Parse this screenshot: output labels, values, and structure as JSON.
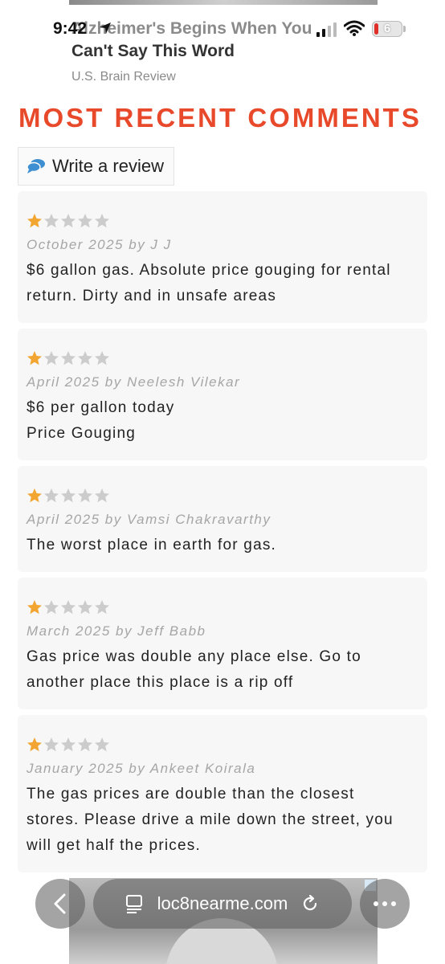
{
  "status_bar": {
    "time": "9:42",
    "battery_level": "6"
  },
  "ad_top": {
    "headline_line1": "Alzheimer's Begins When You",
    "headline_line2": "Can't Say This Word",
    "source": "U.S. Brain Review"
  },
  "section_title": "MOST RECENT COMMENTS",
  "write_review_label": "Write a review",
  "colors": {
    "accent": "#e8492a",
    "star_filled": "#f2a531",
    "star_empty": "#cccccc",
    "chat_icon": "#3d8fd1"
  },
  "reviews": [
    {
      "rating": 1,
      "meta": "October 2025 by J J",
      "text": "$6 gallon gas. Absolute price gouging for rental return. Dirty and in unsafe areas"
    },
    {
      "rating": 1,
      "meta": "April 2025 by Neelesh Vilekar",
      "text_line1": "$6 per gallon today",
      "text_line2": "Price Gouging"
    },
    {
      "rating": 1,
      "meta": "April 2025 by Vamsi Chakravarthy",
      "text": "The worst place in earth for gas."
    },
    {
      "rating": 1,
      "meta": "March 2025 by Jeff Babb",
      "text": "Gas price was double any place else. Go to another place this place is a rip off"
    },
    {
      "rating": 1,
      "meta": "January 2025 by Ankeet Koirala",
      "text": "The gas prices are double than the closest stores. Please drive a mile down the street, you will get half the prices."
    }
  ],
  "browser": {
    "url": "loc8nearme.com",
    "back_icon": "chevron-left-icon",
    "reader_icon": "reader-icon",
    "reload_icon": "reload-icon",
    "more_icon": "more-icon"
  }
}
